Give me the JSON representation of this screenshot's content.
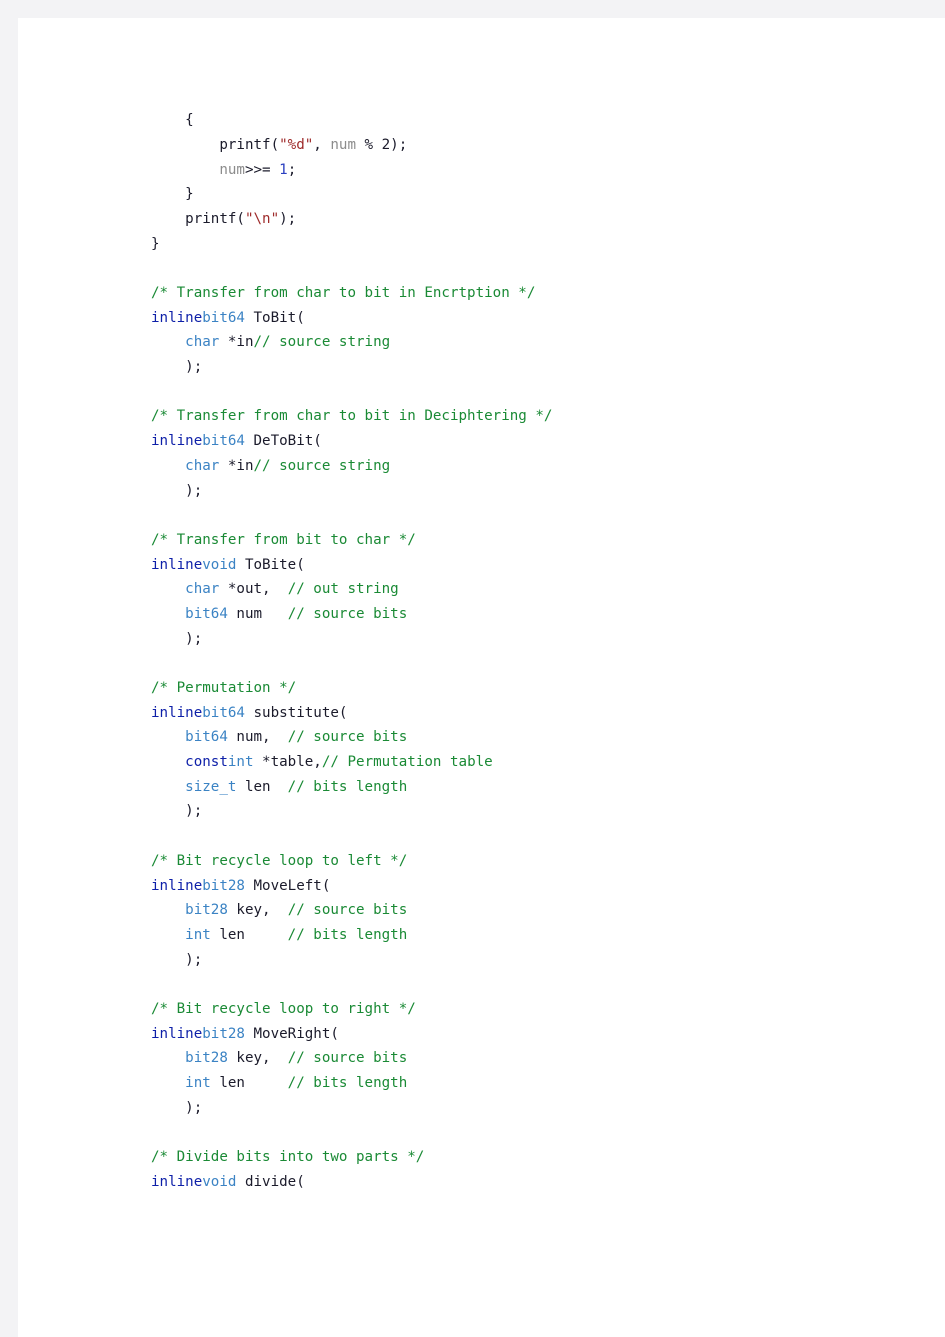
{
  "document": {
    "kind": "source-code-listing",
    "language": "C",
    "page_background": "#ffffff",
    "chrome_background": "#f3f3f5"
  },
  "theme": {
    "plain": "#1b1b2b",
    "comment": "#1a8a35",
    "keyword": "#0d1fa8",
    "type": "#3b83c4",
    "string": "#9e2a2a",
    "identifier": "#8c8c8c",
    "number": "#2a3fc0"
  },
  "code": {
    "lines": [
      {
        "tokens": [
          {
            "t": "    {",
            "c": "plain"
          }
        ]
      },
      {
        "tokens": [
          {
            "t": "        printf(",
            "c": "plain"
          },
          {
            "t": "\"%d\"",
            "c": "str"
          },
          {
            "t": ", ",
            "c": "plain"
          },
          {
            "t": "num",
            "c": "id"
          },
          {
            "t": " % 2);",
            "c": "plain"
          }
        ]
      },
      {
        "tokens": [
          {
            "t": "        ",
            "c": "plain"
          },
          {
            "t": "num",
            "c": "id"
          },
          {
            "t": ">>= ",
            "c": "plain"
          },
          {
            "t": "1",
            "c": "num"
          },
          {
            "t": ";",
            "c": "plain"
          }
        ]
      },
      {
        "tokens": [
          {
            "t": "    }",
            "c": "plain"
          }
        ]
      },
      {
        "tokens": [
          {
            "t": "    printf(",
            "c": "plain"
          },
          {
            "t": "\"\\n\"",
            "c": "str"
          },
          {
            "t": ");",
            "c": "plain"
          }
        ]
      },
      {
        "tokens": [
          {
            "t": "}",
            "c": "plain"
          }
        ]
      },
      {
        "tokens": []
      },
      {
        "tokens": [
          {
            "t": "/* Transfer from char to bit in Encrtption */",
            "c": "comment"
          }
        ]
      },
      {
        "tokens": [
          {
            "t": "inline",
            "c": "kw"
          },
          {
            "t": "bit64",
            "c": "type"
          },
          {
            "t": " ToBit(",
            "c": "plain"
          }
        ]
      },
      {
        "tokens": [
          {
            "t": "    ",
            "c": "plain"
          },
          {
            "t": "char",
            "c": "type"
          },
          {
            "t": " *in",
            "c": "plain"
          },
          {
            "t": "// source string",
            "c": "comment"
          }
        ]
      },
      {
        "tokens": [
          {
            "t": "    );",
            "c": "plain"
          }
        ]
      },
      {
        "tokens": []
      },
      {
        "tokens": [
          {
            "t": "/* Transfer from char to bit in Deciphtering */",
            "c": "comment"
          }
        ]
      },
      {
        "tokens": [
          {
            "t": "inline",
            "c": "kw"
          },
          {
            "t": "bit64",
            "c": "type"
          },
          {
            "t": " DeToBit(",
            "c": "plain"
          }
        ]
      },
      {
        "tokens": [
          {
            "t": "    ",
            "c": "plain"
          },
          {
            "t": "char",
            "c": "type"
          },
          {
            "t": " *in",
            "c": "plain"
          },
          {
            "t": "// source string",
            "c": "comment"
          }
        ]
      },
      {
        "tokens": [
          {
            "t": "    );",
            "c": "plain"
          }
        ]
      },
      {
        "tokens": []
      },
      {
        "tokens": [
          {
            "t": "/* Transfer from bit to char */",
            "c": "comment"
          }
        ]
      },
      {
        "tokens": [
          {
            "t": "inline",
            "c": "kw"
          },
          {
            "t": "void",
            "c": "type"
          },
          {
            "t": " ToBite(",
            "c": "plain"
          }
        ]
      },
      {
        "tokens": [
          {
            "t": "    ",
            "c": "plain"
          },
          {
            "t": "char",
            "c": "type"
          },
          {
            "t": " *out,  ",
            "c": "plain"
          },
          {
            "t": "// out string",
            "c": "comment"
          }
        ]
      },
      {
        "tokens": [
          {
            "t": "    ",
            "c": "plain"
          },
          {
            "t": "bit64",
            "c": "type"
          },
          {
            "t": " num   ",
            "c": "plain"
          },
          {
            "t": "// source bits",
            "c": "comment"
          }
        ]
      },
      {
        "tokens": [
          {
            "t": "    );",
            "c": "plain"
          }
        ]
      },
      {
        "tokens": []
      },
      {
        "tokens": [
          {
            "t": "/* Permutation */",
            "c": "comment"
          }
        ]
      },
      {
        "tokens": [
          {
            "t": "inline",
            "c": "kw"
          },
          {
            "t": "bit64",
            "c": "type"
          },
          {
            "t": " substitute(",
            "c": "plain"
          }
        ]
      },
      {
        "tokens": [
          {
            "t": "    ",
            "c": "plain"
          },
          {
            "t": "bit64",
            "c": "type"
          },
          {
            "t": " num,  ",
            "c": "plain"
          },
          {
            "t": "// source bits",
            "c": "comment"
          }
        ]
      },
      {
        "tokens": [
          {
            "t": "    ",
            "c": "plain"
          },
          {
            "t": "const",
            "c": "kw"
          },
          {
            "t": "int",
            "c": "type"
          },
          {
            "t": " *table,",
            "c": "plain"
          },
          {
            "t": "// Permutation table",
            "c": "comment"
          }
        ]
      },
      {
        "tokens": [
          {
            "t": "    ",
            "c": "plain"
          },
          {
            "t": "size_t",
            "c": "type"
          },
          {
            "t": " len  ",
            "c": "plain"
          },
          {
            "t": "// bits length",
            "c": "comment"
          }
        ]
      },
      {
        "tokens": [
          {
            "t": "    );",
            "c": "plain"
          }
        ]
      },
      {
        "tokens": []
      },
      {
        "tokens": [
          {
            "t": "/* Bit recycle loop to left */",
            "c": "comment"
          }
        ]
      },
      {
        "tokens": [
          {
            "t": "inline",
            "c": "kw"
          },
          {
            "t": "bit28",
            "c": "type"
          },
          {
            "t": " MoveLeft(",
            "c": "plain"
          }
        ]
      },
      {
        "tokens": [
          {
            "t": "    ",
            "c": "plain"
          },
          {
            "t": "bit28",
            "c": "type"
          },
          {
            "t": " key,  ",
            "c": "plain"
          },
          {
            "t": "// source bits",
            "c": "comment"
          }
        ]
      },
      {
        "tokens": [
          {
            "t": "    ",
            "c": "plain"
          },
          {
            "t": "int",
            "c": "type"
          },
          {
            "t": " len     ",
            "c": "plain"
          },
          {
            "t": "// bits length",
            "c": "comment"
          }
        ]
      },
      {
        "tokens": [
          {
            "t": "    );",
            "c": "plain"
          }
        ]
      },
      {
        "tokens": []
      },
      {
        "tokens": [
          {
            "t": "/* Bit recycle loop to right */",
            "c": "comment"
          }
        ]
      },
      {
        "tokens": [
          {
            "t": "inline",
            "c": "kw"
          },
          {
            "t": "bit28",
            "c": "type"
          },
          {
            "t": " MoveRight(",
            "c": "plain"
          }
        ]
      },
      {
        "tokens": [
          {
            "t": "    ",
            "c": "plain"
          },
          {
            "t": "bit28",
            "c": "type"
          },
          {
            "t": " key,  ",
            "c": "plain"
          },
          {
            "t": "// source bits",
            "c": "comment"
          }
        ]
      },
      {
        "tokens": [
          {
            "t": "    ",
            "c": "plain"
          },
          {
            "t": "int",
            "c": "type"
          },
          {
            "t": " len     ",
            "c": "plain"
          },
          {
            "t": "// bits length",
            "c": "comment"
          }
        ]
      },
      {
        "tokens": [
          {
            "t": "    );",
            "c": "plain"
          }
        ]
      },
      {
        "tokens": []
      },
      {
        "tokens": [
          {
            "t": "/* Divide bits into two parts */",
            "c": "comment"
          }
        ]
      },
      {
        "tokens": [
          {
            "t": "inline",
            "c": "kw"
          },
          {
            "t": "void",
            "c": "type"
          },
          {
            "t": " divide(",
            "c": "plain"
          }
        ]
      }
    ]
  }
}
